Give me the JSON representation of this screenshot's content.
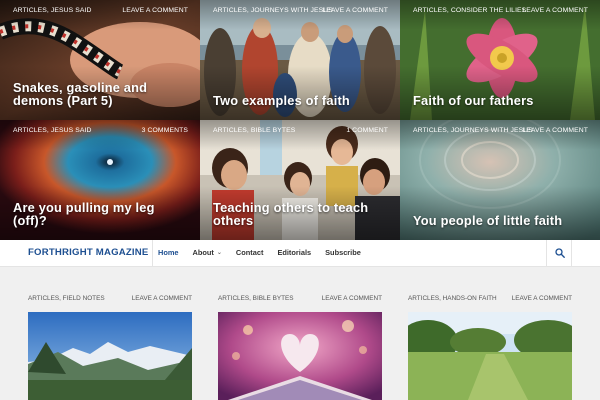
{
  "featured": [
    {
      "categories": "ARTICLES, JESUS SAID",
      "comments": "LEAVE A COMMENT",
      "title": "Snakes, gasoline and demons (Part 5)"
    },
    {
      "categories": "ARTICLES, JOURNEYS WITH JESUS",
      "comments": "LEAVE A COMMENT",
      "title": "Two examples of faith"
    },
    {
      "categories": "ARTICLES, CONSIDER THE LILIES",
      "comments": "LEAVE A COMMENT",
      "title": "Faith of our fathers"
    },
    {
      "categories": "ARTICLES, JESUS SAID",
      "comments": "3 COMMENTS",
      "title": "Are you pulling my leg (off)?"
    },
    {
      "categories": "ARTICLES, BIBLE BYTES",
      "comments": "1 COMMENT",
      "title": "Teaching others to teach others"
    },
    {
      "categories": "ARTICLES, JOURNEYS WITH JESUS",
      "comments": "LEAVE A COMMENT",
      "title": "You people of little faith"
    }
  ],
  "navbar": {
    "brand": "FORTHRIGHT MAGAZINE",
    "items": [
      {
        "label": "Home"
      },
      {
        "label": "About"
      },
      {
        "label": "Contact"
      },
      {
        "label": "Editorials"
      },
      {
        "label": "Subscribe"
      }
    ],
    "search_icon": "search-icon"
  },
  "posts": [
    {
      "categories": "ARTICLES, FIELD NOTES",
      "comments": "LEAVE A COMMENT"
    },
    {
      "categories": "ARTICLES, BIBLE BYTES",
      "comments": "LEAVE A COMMENT"
    },
    {
      "categories": "ARTICLES, HANDS-ON FAITH",
      "comments": "LEAVE A COMMENT"
    }
  ],
  "colors": {
    "brand": "#1d4f91",
    "nav_active": "#1d4f91",
    "page_bg": "#f0f0f0"
  }
}
